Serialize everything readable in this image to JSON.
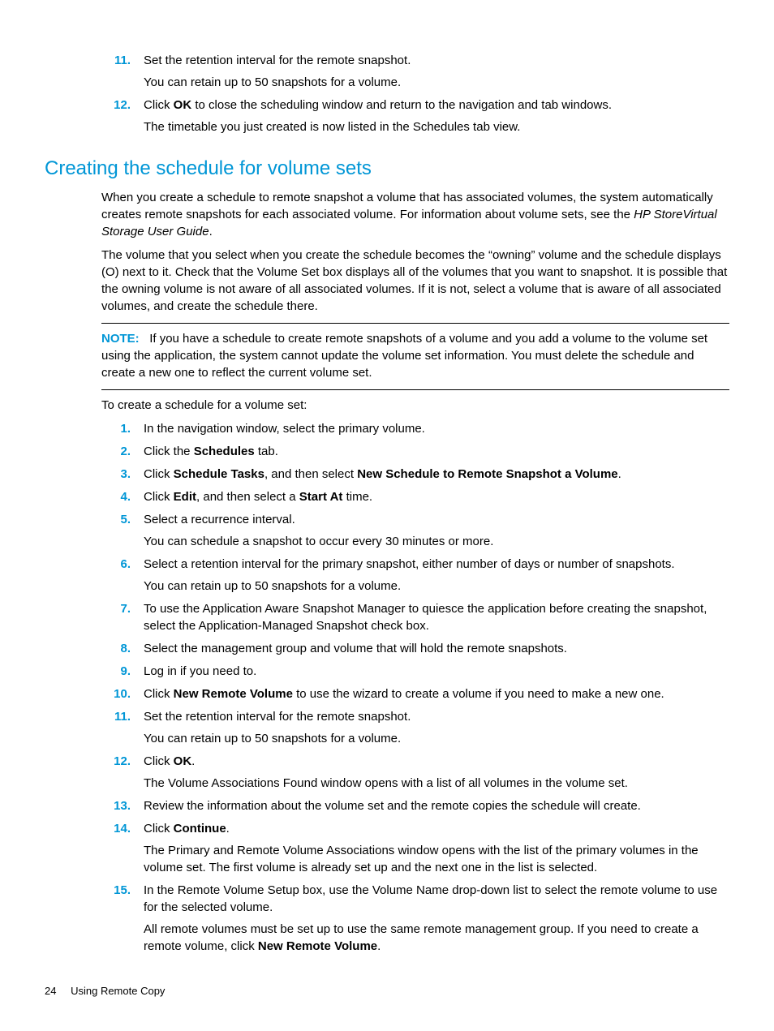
{
  "top_steps": {
    "s11": {
      "num": "11.",
      "p1": "Set the retention interval for the remote snapshot.",
      "p2": "You can retain up to 50 snapshots for a volume."
    },
    "s12": {
      "num": "12.",
      "p1_a": "Click ",
      "p1_b": "OK",
      "p1_c": " to close the scheduling window and return to the navigation and tab windows.",
      "p2": "The timetable you just created is now listed in the Schedules tab view."
    }
  },
  "section_title": "Creating the schedule for volume sets",
  "intro": {
    "p1_a": "When you create a schedule to remote snapshot a volume that has associated volumes, the system automatically creates remote snapshots for each associated volume. For information about volume sets, see the ",
    "p1_i": "HP StoreVirtual Storage User Guide",
    "p1_b": ".",
    "p2": "The volume that you select when you create the schedule becomes the “owning” volume and the schedule displays (O) next to it. Check that the Volume Set box displays all of the volumes that you want to snapshot. It is possible that the owning volume is not aware of all associated volumes. If it is not, select a volume that is aware of all associated volumes, and create the schedule there."
  },
  "note": {
    "label": "NOTE:",
    "text": "If you have a schedule to create remote snapshots of a volume and you add a volume to the volume set using the application, the system cannot update the volume set information. You must delete the schedule and create a new one to reflect the current volume set."
  },
  "proc_intro": "To create a schedule for a volume set:",
  "steps": {
    "s1": {
      "num": "1.",
      "p1": "In the navigation window, select the primary volume."
    },
    "s2": {
      "num": "2.",
      "a": "Click the ",
      "b": "Schedules",
      "c": " tab."
    },
    "s3": {
      "num": "3.",
      "a": "Click ",
      "b": "Schedule Tasks",
      "c": ", and then select ",
      "d": "New Schedule to Remote Snapshot a Volume",
      "e": "."
    },
    "s4": {
      "num": "4.",
      "a": "Click ",
      "b": "Edit",
      "c": ", and then select a ",
      "d": "Start At",
      "e": " time."
    },
    "s5": {
      "num": "5.",
      "p1": "Select a recurrence interval.",
      "p2": "You can schedule a snapshot to occur every 30 minutes or more."
    },
    "s6": {
      "num": "6.",
      "p1": "Select a retention interval for the primary snapshot, either number of days or number of snapshots.",
      "p2": "You can retain up to 50 snapshots for a volume."
    },
    "s7": {
      "num": "7.",
      "p1": "To use the Application Aware Snapshot Manager to quiesce the application before creating the snapshot, select the Application-Managed Snapshot check box."
    },
    "s8": {
      "num": "8.",
      "p1": "Select the management group and volume that will hold the remote snapshots."
    },
    "s9": {
      "num": "9.",
      "p1": "Log in if you need to."
    },
    "s10": {
      "num": "10.",
      "a": "Click ",
      "b": "New Remote Volume",
      "c": " to use the wizard to create a volume if you need to make a new one."
    },
    "s11": {
      "num": "11.",
      "p1": "Set the retention interval for the remote snapshot.",
      "p2": "You can retain up to 50 snapshots for a volume."
    },
    "s12": {
      "num": "12.",
      "a": "Click ",
      "b": "OK",
      "c": ".",
      "p2": "The Volume Associations Found window opens with a list of all volumes in the volume set."
    },
    "s13": {
      "num": "13.",
      "p1": "Review the information about the volume set and the remote copies the schedule will create."
    },
    "s14": {
      "num": "14.",
      "a": "Click ",
      "b": "Continue",
      "c": ".",
      "p2": "The Primary and Remote Volume Associations window opens with the list of the primary volumes in the volume set. The first volume is already set up and the next one in the list is selected."
    },
    "s15": {
      "num": "15.",
      "p1": "In the Remote Volume Setup box, use the Volume Name drop-down list to select the remote volume to use for the selected volume.",
      "p2a": "All remote volumes must be set up to use the same remote management group. If you need to create a remote volume, click ",
      "p2b": "New Remote Volume",
      "p2c": "."
    }
  },
  "footer": {
    "page": "24",
    "chapter": "Using Remote Copy"
  }
}
